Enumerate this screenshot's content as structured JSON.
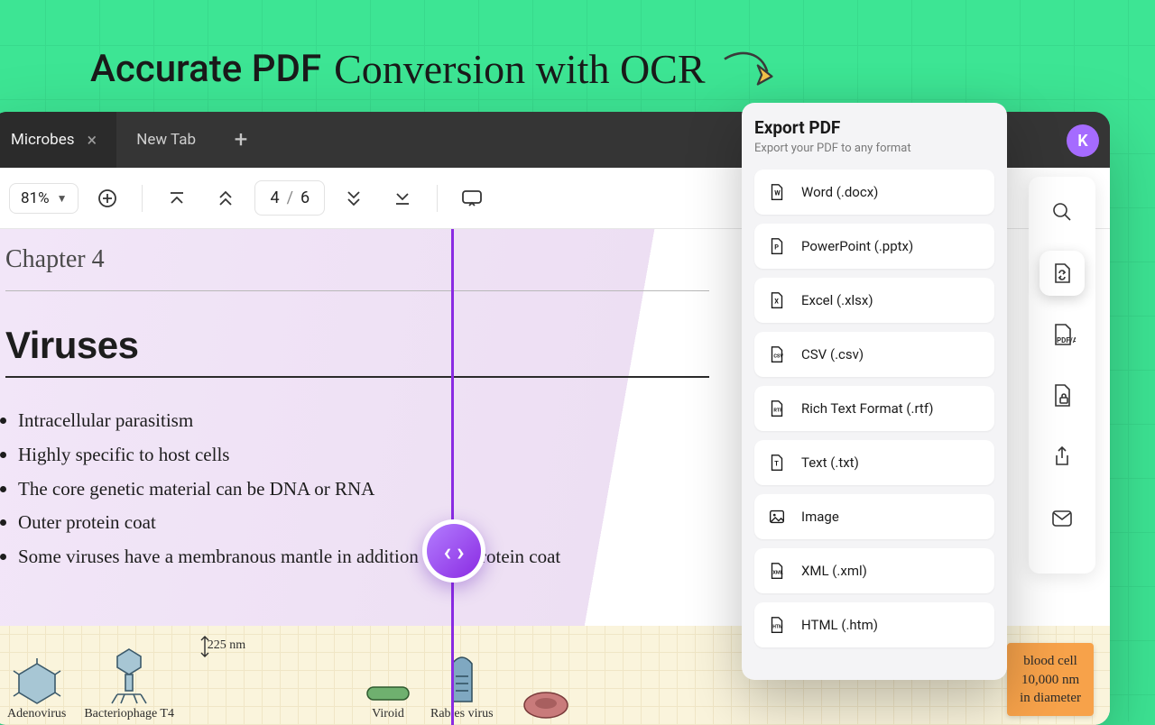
{
  "hero": {
    "bold": "Accurate PDF",
    "script": "Conversion with OCR"
  },
  "tabs": {
    "active": "Microbes",
    "new": "New Tab"
  },
  "avatar": "K",
  "toolbar": {
    "zoom": "81%",
    "page_current": "4",
    "page_total": "6"
  },
  "document": {
    "chapter": "Chapter 4",
    "heading": "Viruses",
    "bullets": [
      "Intracellular parasitism",
      "Highly specific to host cells",
      "The core genetic material can be DNA or RNA",
      "Outer protein coat",
      "Some viruses have a membranous mantle in addition to the protein coat"
    ],
    "diagram": {
      "adenovirus": "Adenovirus",
      "bacteriophage": "Bacteriophage T4",
      "bacteriophage_scale": "225 nm",
      "viroid": "Viroid",
      "rabies": "Rabies virus",
      "rbc_card_l1": "blood cell",
      "rbc_card_l2": "10,000 nm",
      "rbc_card_l3": "in diameter"
    }
  },
  "export": {
    "title": "Export PDF",
    "subtitle": "Export your PDF to any format",
    "formats": [
      "Word (.docx)",
      "PowerPoint (.pptx)",
      "Excel (.xlsx)",
      "CSV (.csv)",
      "Rich Text Format (.rtf)",
      "Text (.txt)",
      "Image",
      "XML (.xml)",
      "HTML (.htm)"
    ]
  }
}
